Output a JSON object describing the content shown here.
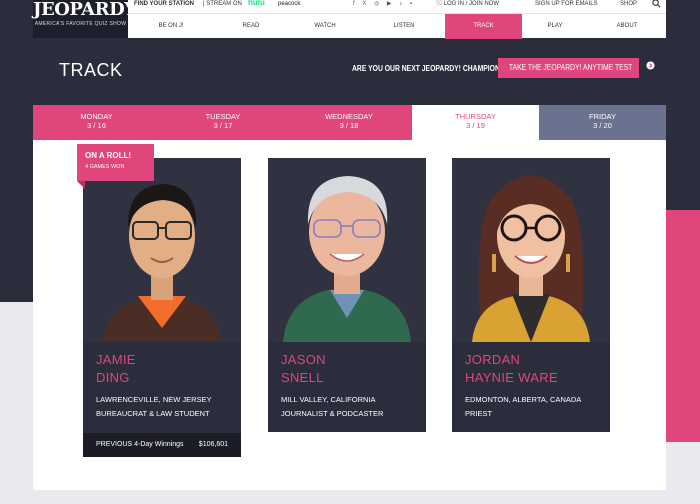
{
  "logo": {
    "title": "JEOPARDY!",
    "subtitle": "AMERICA'S FAVORITE QUIZ SHOW"
  },
  "topbar": {
    "find_station": "FIND YOUR STATION",
    "stream_on": "| STREAM ON",
    "hulu": "hulu",
    "peacock": "peacock",
    "socials": "f X ◎ ▶ ♪ ▪",
    "login": "ⓘ LOG IN / JOIN NOW",
    "signup": "SIGN UP FOR EMAILS",
    "shop": "SHOP",
    "search_icon": "search-icon"
  },
  "nav": {
    "items": [
      {
        "label": "BE ON J!"
      },
      {
        "label": "READ"
      },
      {
        "label": "WATCH"
      },
      {
        "label": "LISTEN"
      },
      {
        "label": "TRACK"
      },
      {
        "label": "PLAY"
      },
      {
        "label": "ABOUT"
      }
    ],
    "active": "TRACK"
  },
  "page": {
    "title": "TRACK",
    "champion_prompt": "ARE YOU OUR NEXT JEOPARDY! CHAMPION?",
    "test_button": "TAKE THE JEOPARDY! ANYTIME TEST"
  },
  "days": [
    {
      "day": "MONDAY",
      "date": "3 / 16"
    },
    {
      "day": "TUESDAY",
      "date": "3 / 17"
    },
    {
      "day": "WEDNESDAY",
      "date": "3 / 18"
    },
    {
      "day": "THURSDAY",
      "date": "3 / 19"
    },
    {
      "day": "FRIDAY",
      "date": "3 / 20"
    }
  ],
  "streak": {
    "title": "ON A ROLL!",
    "subtitle": "4 GAMES WON"
  },
  "contestants": [
    {
      "first": "JAMIE",
      "last": "DING",
      "location": "LAWRENCEVILLE, NEW JERSEY",
      "occupation": "BUREAUCRAT & LAW STUDENT",
      "winnings_label": "PREVIOUS 4-Day Winnings",
      "winnings": "$106,601"
    },
    {
      "first": "JASON",
      "last": "SNELL",
      "location": "MILL VALLEY, CALIFORNIA",
      "occupation": "JOURNALIST & PODCASTER"
    },
    {
      "first": "JORDAN",
      "last": "HAYNIE WARE",
      "location": "EDMONTON, ALBERTA, CANADA",
      "occupation": "PRIEST"
    }
  ],
  "colors": {
    "accent": "#e0457b",
    "dark": "#2b2d3c",
    "slate": "#6b7290"
  }
}
